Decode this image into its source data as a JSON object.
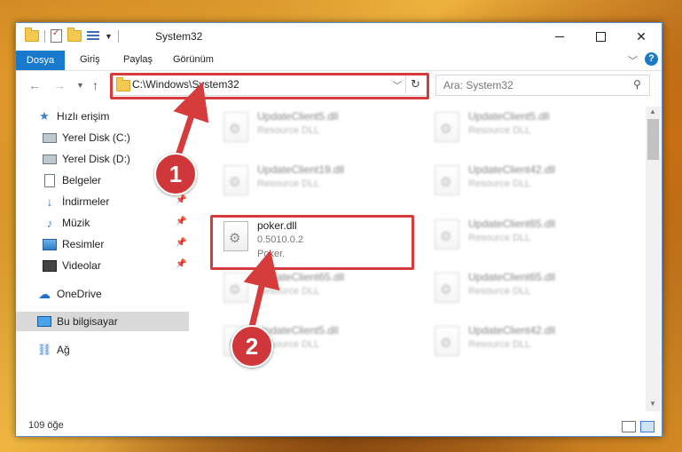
{
  "window": {
    "title": "System32"
  },
  "ribbon": {
    "tabs": [
      "Dosya",
      "Giriş",
      "Paylaş",
      "Görünüm"
    ],
    "help": "?"
  },
  "address": {
    "path": "C:\\Windows\\System32",
    "refresh": "↻"
  },
  "search": {
    "placeholder": "Ara: System32"
  },
  "sidebar": {
    "items": [
      {
        "label": "Hızlı erişim"
      },
      {
        "label": "Yerel Disk (C:)"
      },
      {
        "label": "Yerel Disk (D:)"
      },
      {
        "label": "Belgeler"
      },
      {
        "label": "İndirmeler"
      },
      {
        "label": "Müzik"
      },
      {
        "label": "Resimler"
      },
      {
        "label": "Videolar"
      },
      {
        "label": "OneDrive"
      },
      {
        "label": "Bu bilgisayar"
      },
      {
        "label": "Ağ"
      }
    ]
  },
  "files": [
    {
      "name": "UpdateClient5.dll",
      "desc": "Resource DLL"
    },
    {
      "name": "UpdateClient5.dll",
      "desc": "Resource DLL"
    },
    {
      "name": "UpdateClient19.dll",
      "desc": "Resource DLL"
    },
    {
      "name": "UpdateClient42.dll",
      "desc": "Resource DLL"
    },
    {
      "name": "poker.dll",
      "desc": "0.5010.0.2",
      "desc2": "Poker."
    },
    {
      "name": "UpdateClient65.dll",
      "desc": "Resource DLL"
    },
    {
      "name": "UpdateClient65.dll",
      "desc": "Resource DLL"
    },
    {
      "name": "UpdateClient65.dll",
      "desc": "Resource DLL"
    },
    {
      "name": "UpdateClient5.dll",
      "desc": "Resource DLL"
    },
    {
      "name": "UpdateClient42.dll",
      "desc": "Resource DLL"
    }
  ],
  "status": {
    "count": "109 öğe"
  },
  "callouts": [
    "1",
    "2"
  ],
  "colors": {
    "accent": "#1979ca",
    "highlight": "#d63c3c"
  }
}
